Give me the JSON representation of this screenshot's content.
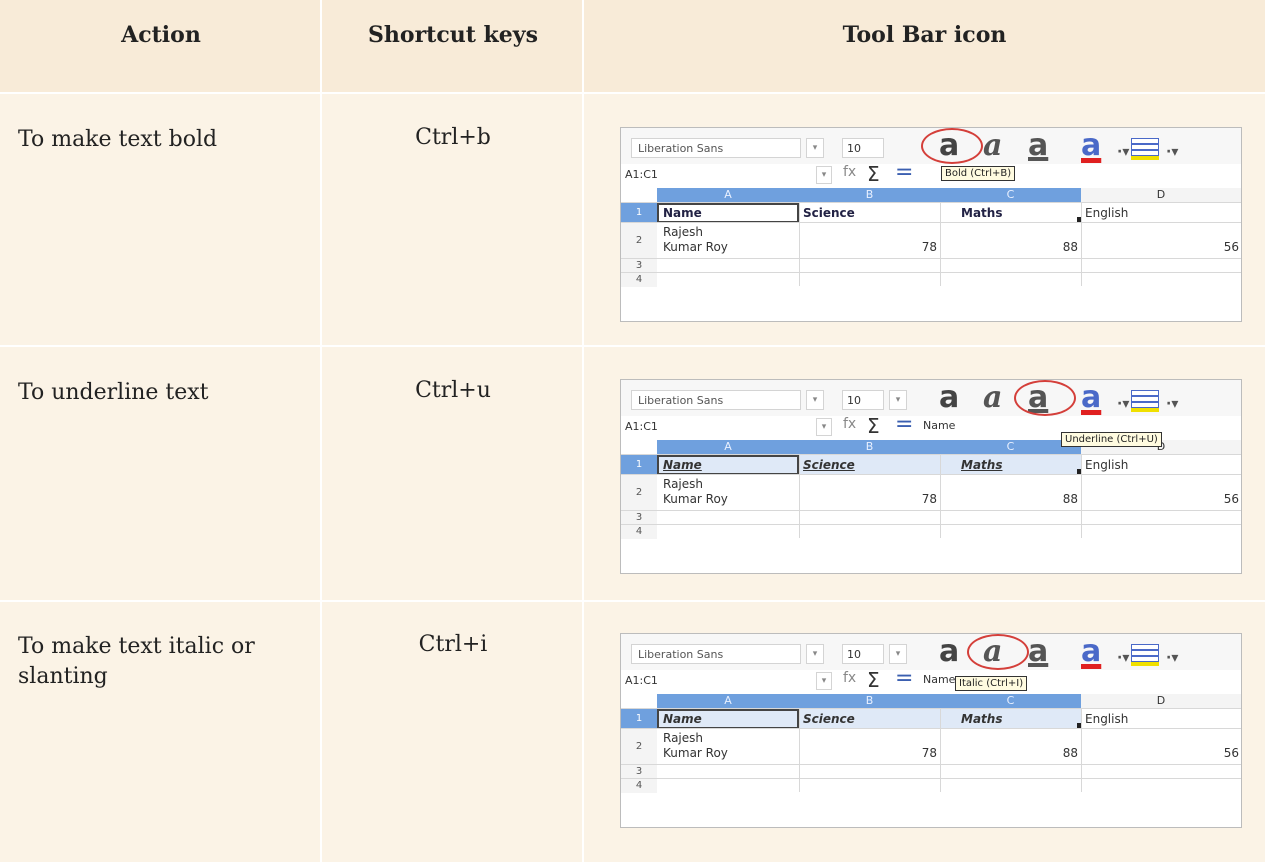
{
  "headers": {
    "action": "Action",
    "keys": "Shortcut keys",
    "icon": "Tool Bar icon"
  },
  "rows": [
    {
      "action": "To make text bold",
      "keys": "Ctrl+b",
      "shot": {
        "font": "Liberation Sans",
        "size": "10",
        "namebox": "A1:C1",
        "formula": "",
        "tooltip": "Bold (Ctrl+B)",
        "circled": "bold-icon"
      }
    },
    {
      "action": "To underline text",
      "keys": "Ctrl+u",
      "shot": {
        "font": "Liberation Sans",
        "size": "10",
        "namebox": "A1:C1",
        "formula": "Name",
        "tooltip": "Underline (Ctrl+U)",
        "circled": "underline-icon"
      }
    },
    {
      "action": "To make text italic or slanting",
      "keys": "Ctrl+i",
      "shot": {
        "font": "Liberation Sans",
        "size": "10",
        "namebox": "A1:C1",
        "formula": "Name",
        "tooltip": "Italic (Ctrl+I)",
        "circled": "italic-icon"
      }
    }
  ],
  "sheet": {
    "columns": [
      "A",
      "B",
      "C",
      "D"
    ],
    "row_numbers": [
      "1",
      "2",
      "3",
      "4"
    ],
    "header_cells": [
      "Name",
      "Science",
      "Maths",
      "English"
    ],
    "name_line1": "Rajesh",
    "name_line2": "Kumar Roy",
    "values": [
      "78",
      "88",
      "56"
    ]
  },
  "toolbar_glyphs": {
    "bold": "a",
    "italic": "a",
    "underline": "a",
    "color": "a",
    "drop": "·▾",
    "dd": "▾",
    "fx": "fx",
    "sum": "Σ",
    "eq": "="
  },
  "colors": {
    "header_bg": "#f8ebd8",
    "row_bg": "#fbf3e6",
    "selection": "#6fa0de",
    "circle": "#d43f3a"
  }
}
